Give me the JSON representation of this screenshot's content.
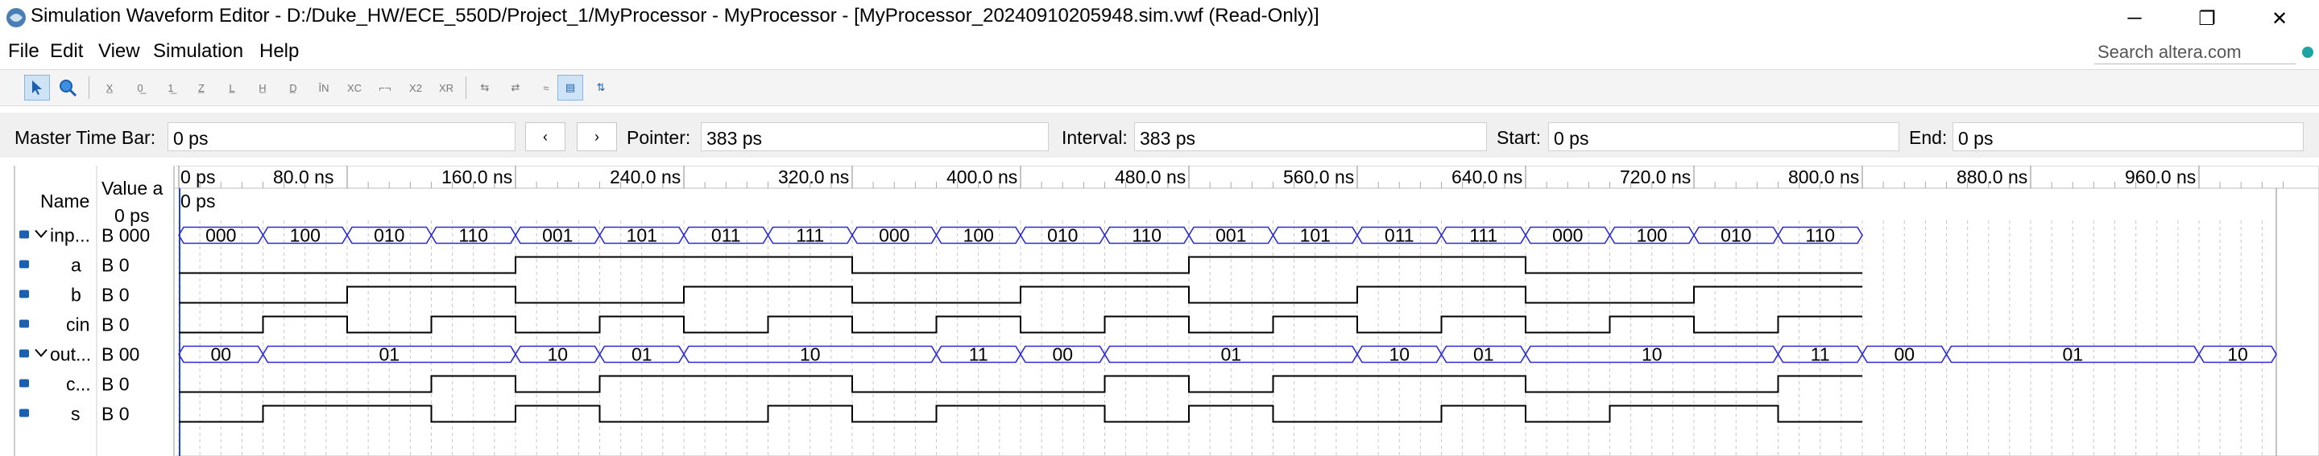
{
  "window": {
    "title": "Simulation Waveform Editor - D:/Duke_HW/ECE_550D/Project_1/MyProcessor - MyProcessor - [MyProcessor_20240910205948.sim.vwf (Read-Only)]",
    "minimize_glyph": "─",
    "maximize_glyph": "❐",
    "close_glyph": "✕"
  },
  "menu": [
    "File",
    "Edit",
    "View",
    "Simulation",
    "Help"
  ],
  "search": {
    "placeholder": "Search altera.com"
  },
  "toolbar": {
    "tools": [
      "pointer-icon",
      "zoom-icon",
      "force-unknown-icon",
      "force-low-icon",
      "force-high-icon",
      "force-hiz-icon",
      "force-weak-low-icon",
      "force-weak-high-icon",
      "force-dont-care-icon",
      "invert-icon",
      "count-value-icon",
      "clock-icon",
      "random-value-icon",
      "overwrite-icon",
      "snap-grid-icon",
      "reverse-icon",
      "arbitrary-icon",
      "grid-icon",
      "sort-icon"
    ]
  },
  "timebar": {
    "master_label": "Master Time Bar:",
    "master_value": "0 ps",
    "prev_glyph": "‹",
    "next_glyph": "›",
    "pointer_label": "Pointer:",
    "pointer_value": "383 ps",
    "interval_label": "Interval:",
    "interval_value": "383 ps",
    "start_label": "Start:",
    "start_value": "0 ps",
    "end_label": "End:",
    "end_value": "0 ps"
  },
  "columns": {
    "name": "Name",
    "value": "Value a",
    "value2": "0 ps"
  },
  "time_labels": [
    "0 ps",
    "80.0 ns",
    "160.0 ns",
    "240.0 ns",
    "320.0 ns",
    "400.0 ns",
    "480.0 ns",
    "560.0 ns",
    "640.0 ns",
    "720.0 ns",
    "800.0 ns",
    "880.0 ns",
    "960.0 ns"
  ],
  "cursor_label": "0 ps",
  "signals": [
    {
      "name": "inp...",
      "value": "B 000",
      "type": "bus",
      "group": true,
      "segments": [
        {
          "t0": 0,
          "t1": 40,
          "label": "000"
        },
        {
          "t0": 40,
          "t1": 80,
          "label": "100"
        },
        {
          "t0": 80,
          "t1": 120,
          "label": "010"
        },
        {
          "t0": 120,
          "t1": 160,
          "label": "110"
        },
        {
          "t0": 160,
          "t1": 200,
          "label": "001"
        },
        {
          "t0": 200,
          "t1": 240,
          "label": "101"
        },
        {
          "t0": 240,
          "t1": 280,
          "label": "011"
        },
        {
          "t0": 280,
          "t1": 320,
          "label": "111"
        },
        {
          "t0": 320,
          "t1": 360,
          "label": "000"
        },
        {
          "t0": 360,
          "t1": 400,
          "label": "100"
        },
        {
          "t0": 400,
          "t1": 440,
          "label": "010"
        },
        {
          "t0": 440,
          "t1": 480,
          "label": "110"
        },
        {
          "t0": 480,
          "t1": 520,
          "label": "001"
        },
        {
          "t0": 520,
          "t1": 560,
          "label": "101"
        },
        {
          "t0": 560,
          "t1": 600,
          "label": "011"
        },
        {
          "t0": 600,
          "t1": 640,
          "label": "111"
        },
        {
          "t0": 640,
          "t1": 680,
          "label": "000"
        },
        {
          "t0": 680,
          "t1": 720,
          "label": "100"
        },
        {
          "t0": 720,
          "t1": 760,
          "label": "010"
        },
        {
          "t0": 760,
          "t1": 800,
          "label": "110"
        }
      ]
    },
    {
      "name": "a",
      "value": "B 0",
      "type": "bit",
      "levels": [
        0,
        0,
        0,
        0,
        1,
        1,
        1,
        1,
        0,
        0,
        0,
        0,
        1,
        1,
        1,
        1,
        0,
        0,
        0,
        0
      ]
    },
    {
      "name": "b",
      "value": "B 0",
      "type": "bit",
      "levels": [
        0,
        0,
        1,
        1,
        0,
        0,
        1,
        1,
        0,
        0,
        1,
        1,
        0,
        0,
        1,
        1,
        0,
        0,
        1,
        1
      ]
    },
    {
      "name": "cin",
      "value": "B 0",
      "type": "bit",
      "levels": [
        0,
        1,
        0,
        1,
        0,
        1,
        0,
        1,
        0,
        1,
        0,
        1,
        0,
        1,
        0,
        1,
        0,
        1,
        0,
        1
      ]
    },
    {
      "name": "out...",
      "value": "B 00",
      "type": "bus",
      "group": true,
      "segments": [
        {
          "t0": 0,
          "t1": 40,
          "label": "00"
        },
        {
          "t0": 40,
          "t1": 160,
          "label": "01"
        },
        {
          "t0": 160,
          "t1": 200,
          "label": "10"
        },
        {
          "t0": 200,
          "t1": 240,
          "label": "01"
        },
        {
          "t0": 240,
          "t1": 360,
          "label": "10"
        },
        {
          "t0": 360,
          "t1": 400,
          "label": "11"
        },
        {
          "t0": 400,
          "t1": 440,
          "label": "00"
        },
        {
          "t0": 440,
          "t1": 560,
          "label": "01"
        },
        {
          "t0": 560,
          "t1": 600,
          "label": "10"
        },
        {
          "t0": 600,
          "t1": 640,
          "label": "01"
        },
        {
          "t0": 640,
          "t1": 760,
          "label": "10"
        },
        {
          "t0": 760,
          "t1": 800,
          "label": "11"
        },
        {
          "t0": 800,
          "t1": 840,
          "label": "00"
        },
        {
          "t0": 840,
          "t1": 960,
          "label": "01"
        },
        {
          "t0": 960,
          "t1": 1000,
          "label": "10"
        }
      ]
    },
    {
      "name": "c...",
      "value": "B 0",
      "type": "bit",
      "levels": [
        0,
        0,
        0,
        1,
        0,
        1,
        1,
        1,
        0,
        0,
        0,
        1,
        0,
        1,
        1,
        1,
        0,
        0,
        0,
        1
      ]
    },
    {
      "name": "s",
      "value": "B 0",
      "type": "bit",
      "levels": [
        0,
        1,
        1,
        0,
        1,
        0,
        0,
        1,
        0,
        1,
        1,
        0,
        1,
        0,
        0,
        1,
        0,
        1,
        1,
        0
      ]
    }
  ],
  "colors": {
    "bus": "#2b2bd6",
    "wave": "#000000",
    "grid": "#c8c8c8",
    "cursor": "#2244cc"
  }
}
